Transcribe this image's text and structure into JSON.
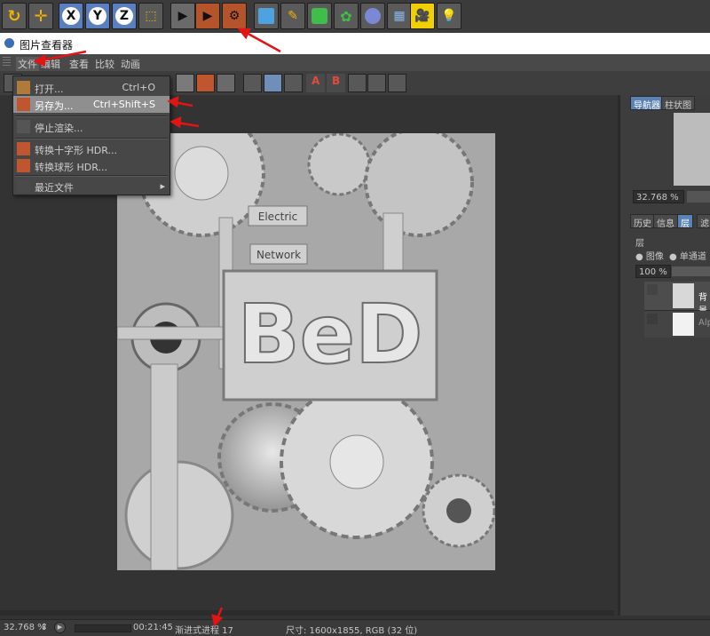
{
  "window": {
    "title": "图片查看器"
  },
  "menu": {
    "items": [
      "文件",
      "编辑",
      "查看",
      "比较",
      "动画"
    ]
  },
  "file_menu": {
    "items": [
      {
        "label": "打开...",
        "shortcut": "Ctrl+O"
      },
      {
        "label": "另存为...",
        "shortcut": "Ctrl+Shift+S"
      },
      {
        "label": "停止渲染...",
        "shortcut": ""
      },
      {
        "label": "转换十字形 HDR...",
        "shortcut": ""
      },
      {
        "label": "转换球形 HDR...",
        "shortcut": ""
      },
      {
        "label": "最近文件",
        "shortcut": "▸"
      }
    ]
  },
  "top_toolbar": {
    "axis_x": "X",
    "axis_y": "Y",
    "axis_z": "Z"
  },
  "image_text": {
    "line1": "Electric",
    "line2": "Network",
    "letters": "BeD"
  },
  "right_panel": {
    "tab_navigator": "导航器",
    "tab_histogram": "柱状图",
    "zoom": "32.768 %",
    "tab_history": "历史",
    "tab_info": "信息",
    "tab_layer": "层",
    "tab_filter": "滤",
    "layer_header": "层",
    "radio_image": "图像",
    "radio_single": "单通道",
    "opacity": "100 %",
    "layer_background": "背景",
    "layer_alpha": "Alp"
  },
  "status": {
    "zoom": "32.768 %",
    "time": "00:21:45",
    "progress": "渐进式进程 17",
    "size": "尺寸: 1600x1855, RGB (32 位)"
  },
  "colors": {
    "accent": "#5b82b5",
    "annotation": "#e21414",
    "highlight": "#f2c300"
  }
}
